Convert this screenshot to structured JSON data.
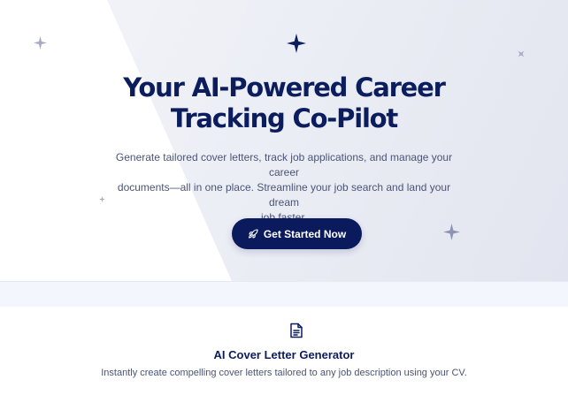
{
  "hero": {
    "title_line1": "Your AI-Powered Career",
    "title_line2": "Tracking Co-Pilot",
    "subtitle_line1": "Generate tailored cover letters, track job applications, and manage your career",
    "subtitle_line2": "documents—all in one place. Streamline your job search and land your dream",
    "subtitle_line3": "job faster.",
    "cta_label": "Get Started Now",
    "cta_icon": "rocket-icon"
  },
  "decorations": {
    "sparkle_icon": "sparkle-icon"
  },
  "feature": {
    "icon": "document-icon",
    "title": "AI Cover Letter Generator",
    "description": "Instantly create compelling cover letters tailored to any job description using your CV."
  },
  "colors": {
    "brand_navy": "#0c1d5e",
    "button_bg": "#0a1a5c",
    "body_text": "#4a5476",
    "band_bg": "#f3f6fd",
    "sparkle_dark": "#0c1d5e",
    "sparkle_light": "#a4aac6"
  }
}
